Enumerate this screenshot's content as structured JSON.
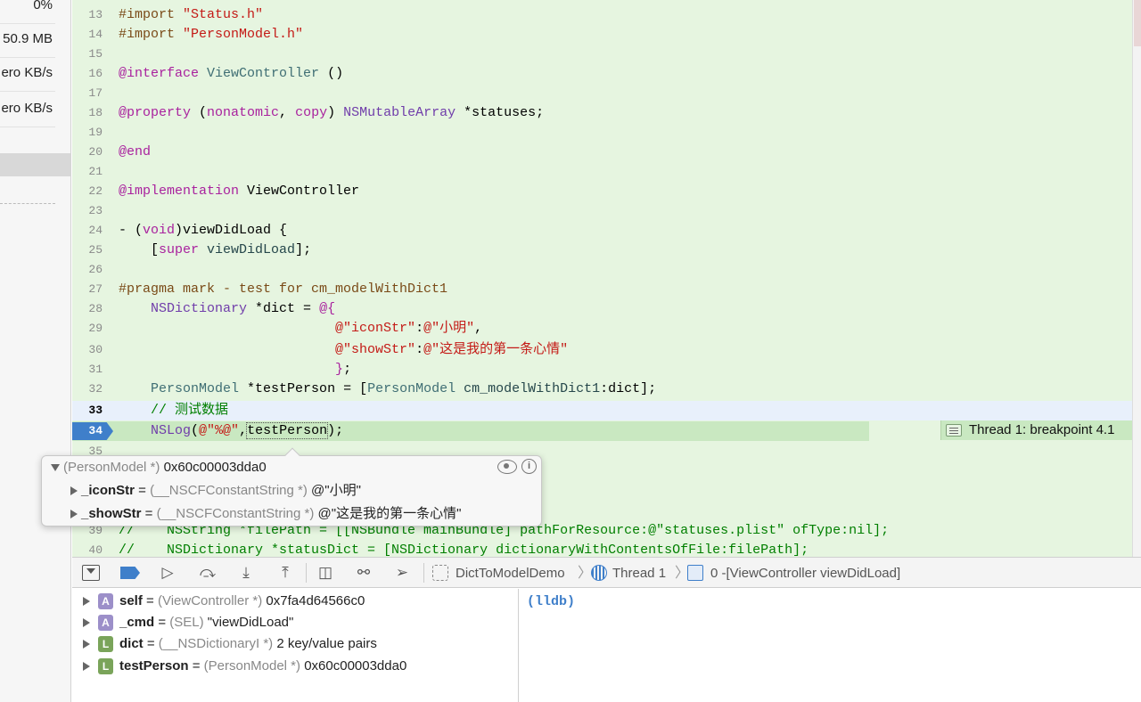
{
  "gauges": [
    "0%",
    "50.9 MB",
    "ero KB/s",
    "ero KB/s"
  ],
  "code_lines": [
    {
      "n": "13",
      "segments": [
        {
          "t": "#import ",
          "c": "dir"
        },
        {
          "t": "\"Status.h\"",
          "c": "str"
        }
      ]
    },
    {
      "n": "14",
      "segments": [
        {
          "t": "#import ",
          "c": "dir"
        },
        {
          "t": "\"PersonModel.h\"",
          "c": "str"
        }
      ]
    },
    {
      "n": "15",
      "segments": []
    },
    {
      "n": "16",
      "segments": [
        {
          "t": "@interface",
          "c": "kw"
        },
        {
          "t": " "
        },
        {
          "t": "ViewController",
          "c": "cls"
        },
        {
          "t": " ()"
        }
      ]
    },
    {
      "n": "17",
      "segments": []
    },
    {
      "n": "18",
      "segments": [
        {
          "t": "@property",
          "c": "kw"
        },
        {
          "t": " ("
        },
        {
          "t": "nonatomic",
          "c": "kw"
        },
        {
          "t": ", "
        },
        {
          "t": "copy",
          "c": "kw"
        },
        {
          "t": ") "
        },
        {
          "t": "NSMutableArray",
          "c": "prop"
        },
        {
          "t": " *statuses;"
        }
      ]
    },
    {
      "n": "19",
      "segments": []
    },
    {
      "n": "20",
      "segments": [
        {
          "t": "@end",
          "c": "kw"
        }
      ]
    },
    {
      "n": "21",
      "segments": []
    },
    {
      "n": "22",
      "segments": [
        {
          "t": "@implementation",
          "c": "kw"
        },
        {
          "t": " ViewController"
        }
      ]
    },
    {
      "n": "23",
      "segments": []
    },
    {
      "n": "24",
      "segments": [
        {
          "t": "- ("
        },
        {
          "t": "void",
          "c": "kw"
        },
        {
          "t": ")viewDidLoad {"
        }
      ]
    },
    {
      "n": "25",
      "segments": [
        {
          "t": "    ["
        },
        {
          "t": "super",
          "c": "kw"
        },
        {
          "t": " "
        },
        {
          "t": "viewDidLoad",
          "c": "meth"
        },
        {
          "t": "];"
        }
      ]
    },
    {
      "n": "26",
      "segments": []
    },
    {
      "n": "27",
      "segments": [
        {
          "t": "#pragma mark - test for cm_modelWithDict1",
          "c": "dir"
        }
      ]
    },
    {
      "n": "28",
      "segments": [
        {
          "t": "    "
        },
        {
          "t": "NSDictionary",
          "c": "prop"
        },
        {
          "t": " *dict = "
        },
        {
          "t": "@{",
          "c": "kw"
        }
      ]
    },
    {
      "n": "29",
      "segments": [
        {
          "t": "                           "
        },
        {
          "t": "@\"iconStr\"",
          "c": "str"
        },
        {
          "t": ":"
        },
        {
          "t": "@\"小明\"",
          "c": "str"
        },
        {
          "t": ","
        }
      ]
    },
    {
      "n": "30",
      "segments": [
        {
          "t": "                           "
        },
        {
          "t": "@\"showStr\"",
          "c": "str"
        },
        {
          "t": ":"
        },
        {
          "t": "@\"这是我的第一条心情\"",
          "c": "str"
        }
      ]
    },
    {
      "n": "31",
      "segments": [
        {
          "t": "                           "
        },
        {
          "t": "}",
          "c": "kw"
        },
        {
          "t": ";"
        }
      ]
    },
    {
      "n": "32",
      "segments": [
        {
          "t": "    "
        },
        {
          "t": "PersonModel",
          "c": "cls"
        },
        {
          "t": " *testPerson = ["
        },
        {
          "t": "PersonModel",
          "c": "cls"
        },
        {
          "t": " "
        },
        {
          "t": "cm_modelWithDict1",
          "c": "meth"
        },
        {
          "t": ":dict];"
        }
      ]
    },
    {
      "n": "33",
      "segments": [
        {
          "t": "    "
        },
        {
          "t": "// 测试数据",
          "c": "cmt"
        }
      ]
    },
    {
      "n": "34",
      "segments": [
        {
          "t": "    "
        },
        {
          "t": "NSLog",
          "c": "prop"
        },
        {
          "t": "("
        },
        {
          "t": "@\"%@\"",
          "c": "str"
        },
        {
          "t": ","
        },
        {
          "t": "testPerson",
          "c": "dotted"
        },
        {
          "t": ");"
        }
      ]
    },
    {
      "n": "35",
      "segments": []
    },
    {
      "n": "39",
      "segments": [
        {
          "t": "//    NSString *filePath = [[NSBundle mainBundle] pathForResource:@\"statuses.plist\" ofType:nil];",
          "c": "cmt"
        }
      ]
    },
    {
      "n": "40",
      "segments": [
        {
          "t": "//    NSDictionary *statusDict = [NSDictionary dictionaryWithContentsOfFile:filePath];",
          "c": "cmt"
        }
      ]
    }
  ],
  "thread_badge": "Thread 1: breakpoint 4.1",
  "popover": {
    "header_type": "(PersonModel *)",
    "header_addr": "0x60c00003dda0",
    "rows": [
      {
        "name": "_iconStr",
        "eq": " = ",
        "type": "(__NSCFConstantString *)",
        "value": " @\"小明\""
      },
      {
        "name": "_showStr",
        "eq": " = ",
        "type": "(__NSCFConstantString *)",
        "value": " @\"这是我的第一条心情\""
      }
    ]
  },
  "debug_bar": {
    "crumbs": [
      "DictToModelDemo",
      "Thread 1",
      "0 -[ViewController viewDidLoad]"
    ]
  },
  "variables": [
    {
      "badge": "A",
      "name": "self",
      "eq": " = ",
      "type": "(ViewController *)",
      "value": " 0x7fa4d64566c0"
    },
    {
      "badge": "A",
      "name": "_cmd",
      "eq": " = ",
      "type": "(SEL)",
      "value": " \"viewDidLoad\""
    },
    {
      "badge": "L",
      "name": "dict",
      "eq": " = ",
      "type": "(__NSDictionaryI *)",
      "value": " 2 key/value pairs"
    },
    {
      "badge": "L",
      "name": "testPerson",
      "eq": " = ",
      "type": "(PersonModel *)",
      "value": " 0x60c00003dda0"
    }
  ],
  "console": {
    "prompt": "(lldb)"
  },
  "colors": {
    "editor_bg": "#e6f5e0",
    "breakpoint": "#3f7fca",
    "current_line": "#e8f0fb",
    "string": "#c41a16",
    "keyword": "#a9229e",
    "comment": "#017f00"
  }
}
